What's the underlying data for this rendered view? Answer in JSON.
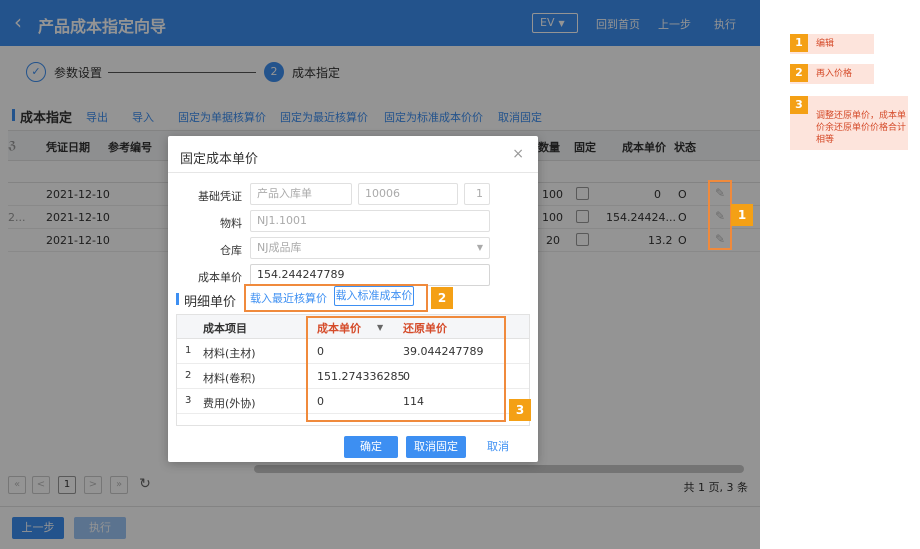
{
  "app": {
    "title": "产品成本指定向导",
    "ev_label": "EV",
    "home_label": "回到首页",
    "prev_label": "上一步",
    "run_label": "执行"
  },
  "steps": [
    {
      "label": "参数设置",
      "state": "done"
    },
    {
      "number": "2",
      "label": "成本指定",
      "state": "active"
    }
  ],
  "toolbar": {
    "section_title": "成本指定",
    "actions": [
      "导出",
      "导入",
      "固定为单据核算价",
      "固定为最近核算价",
      "固定为标准成本价价",
      "取消固定"
    ]
  },
  "grid": {
    "headers": [
      "凭证日期",
      "参考编号",
      "数量",
      "固定",
      "成本单价",
      "状态"
    ],
    "rows": [
      {
        "date": "2021-12-10",
        "qty": "100",
        "unit_cost": "0",
        "status": "O"
      },
      {
        "date": "2021-12-10",
        "qty": "100",
        "unit_cost": "154.24424...",
        "status": "O"
      },
      {
        "date": "2021-12-10",
        "qty": "20",
        "unit_cost": "13.2",
        "status": "O"
      }
    ],
    "left_truncations": [
      "ℨ",
      "2..."
    ]
  },
  "pager": {
    "first": "«",
    "prev": "<",
    "page": "1",
    "next": ">",
    "last": "»",
    "refresh": "↻",
    "total_text": "共 1 页, 3 条"
  },
  "footer": {
    "prev_label": "上一步",
    "run_label": "执行"
  },
  "modal": {
    "title": "固定成本单价",
    "close": "×",
    "fields": {
      "basic_voucher_label": "基础凭证",
      "voucher_type": "产品入库单",
      "voucher_no": "10006",
      "voucher_line": "1",
      "material_label": "物料",
      "material_value": "NJ1.1001",
      "warehouse_label": "仓库",
      "warehouse_value": "NJ成品库",
      "unit_cost_label": "成本单价",
      "unit_cost_value": "154.244247789"
    },
    "detail": {
      "section_title": "明细单价",
      "load_recent": "载入最近核算价",
      "load_standard": "载入标准成本价",
      "headers": [
        "成本项目",
        "成本单价",
        "还原单价"
      ],
      "rows": [
        {
          "no": "1",
          "item": "材料(主材)",
          "unit_cost": "0",
          "restore": "39.044247789"
        },
        {
          "no": "2",
          "item": "材料(卷积)",
          "unit_cost": "151.274336285",
          "restore": "0"
        },
        {
          "no": "3",
          "item": "费用(外协)",
          "unit_cost": "0",
          "restore": "114"
        }
      ]
    },
    "buttons": {
      "confirm": "确定",
      "unfix": "取消固定",
      "cancel": "取消"
    }
  },
  "annotations": {
    "badges": [
      "1",
      "2",
      "3"
    ],
    "notes": [
      {
        "number": "1",
        "text": "编辑"
      },
      {
        "number": "2",
        "text": "再入价格"
      },
      {
        "number": "3",
        "text": "调整还原单价，成本单价余还原单价价格合计相等"
      }
    ]
  },
  "colors": {
    "primary": "#3d8ff2",
    "highlight": "#f08a3c",
    "badge": "#f4a015",
    "note_bg": "#fde4dc",
    "note_text": "#d54b2a"
  }
}
